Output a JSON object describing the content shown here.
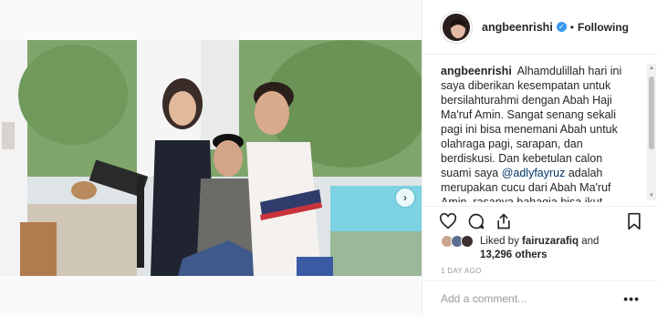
{
  "post": {
    "username": "angbeenrishi",
    "separator": "•",
    "follow_state": "Following",
    "caption_user": "angbeenrishi",
    "caption_part1": "Alhamdulillah hari ini saya diberikan kesempatan untuk bersilahturahmi dengan Abah Haji Ma'ruf Amin. Sangat senang sekali pagi ini bisa menemani Abah untuk olahraga pagi, sarapan, dan berdiskusi. Dan kebetulan calon suami saya ",
    "caption_mention": "@adlyfayruz",
    "caption_part2": " adalah merupakan cucu dari Abah Ma'ruf Amin, rasanya bahagia bisa ikut berkumpul keluarga sambil berdiskusi politik . Hal yang cukup membuat saya berkesan adalah",
    "likes_prefix": "Liked by ",
    "likes_user": "fairuzarafiq",
    "likes_and": " and",
    "likes_count": "13,296 others",
    "timestamp": "1 DAY AGO",
    "comment_placeholder": "Add a comment...",
    "more_label": "•••",
    "carousel_arrow": "›"
  },
  "icons": {
    "verified": "verified-badge-icon",
    "like": "heart-icon",
    "comment": "comment-icon",
    "share": "share-icon",
    "save": "bookmark-icon"
  },
  "colors": {
    "accent": "#3897f0",
    "mention": "#003569",
    "text": "#262626",
    "muted": "#999999"
  }
}
